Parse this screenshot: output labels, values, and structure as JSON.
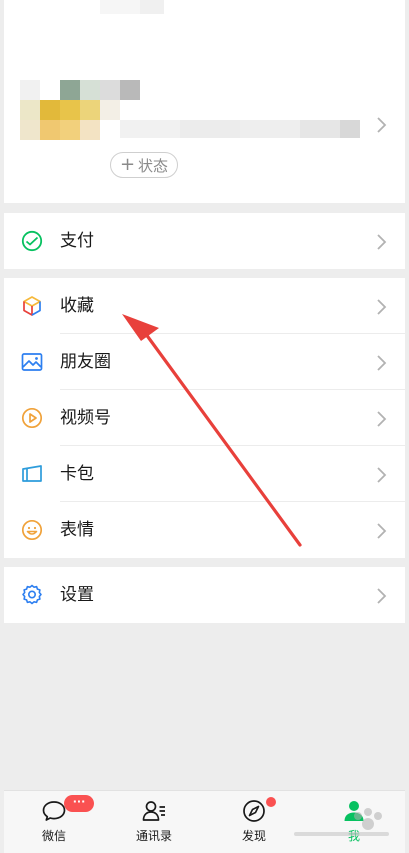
{
  "profile": {
    "status_label": "状态",
    "status_icon": "plus-icon"
  },
  "menu": [
    {
      "label": "支付",
      "icon": "pay-icon"
    },
    {
      "label": "收藏",
      "icon": "favorites-icon"
    },
    {
      "label": "朋友圈",
      "icon": "moments-icon"
    },
    {
      "label": "视频号",
      "icon": "channels-icon"
    },
    {
      "label": "卡包",
      "icon": "card-wallet-icon"
    },
    {
      "label": "表情",
      "icon": "sticker-icon"
    },
    {
      "label": "设置",
      "icon": "settings-icon"
    }
  ],
  "tabbar": {
    "tabs": [
      {
        "label": "微信",
        "icon": "chat-icon",
        "badge": "···"
      },
      {
        "label": "通讯录",
        "icon": "contacts-icon"
      },
      {
        "label": "发现",
        "icon": "discover-icon"
      },
      {
        "label": "我",
        "icon": "me-icon",
        "active": true
      }
    ]
  },
  "colors": {
    "accent": "#07c160",
    "badge": "#fa5151",
    "arrow": "#e8403b",
    "background": "#ededed"
  }
}
